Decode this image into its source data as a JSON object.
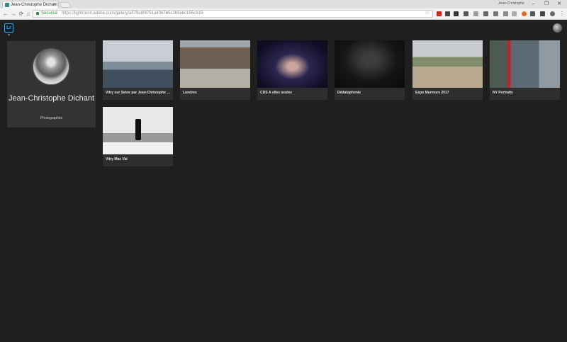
{
  "browser": {
    "tab_title": "Jean-Christophe Dichant",
    "tab_close": "×",
    "window_user": "Jean-Christophe",
    "window_controls": [
      "–",
      "❐",
      "✕"
    ],
    "secure_label": "Sécurisé",
    "url": "https://lightroom.adobe.com/gallery/a579e8f4751a4367b5c2b6ebc155c315",
    "nav": [
      "←",
      "→",
      "⟳",
      "⌂"
    ]
  },
  "app": {
    "logo_text": "Lr",
    "brand_color": "#4ea4d7"
  },
  "profile": {
    "name": "Jean-Christophe Dichant",
    "role": "Photographes"
  },
  "galleries": [
    {
      "title": "Vitry sur Seine par Jean-Christophe Dichant"
    },
    {
      "title": "Londres"
    },
    {
      "title": "CDS À elles seules"
    },
    {
      "title": "Dédalophonie"
    },
    {
      "title": "Expo Murmurs 2017"
    },
    {
      "title": "NY Portraits"
    },
    {
      "title": "Vitry Mac Val"
    }
  ]
}
